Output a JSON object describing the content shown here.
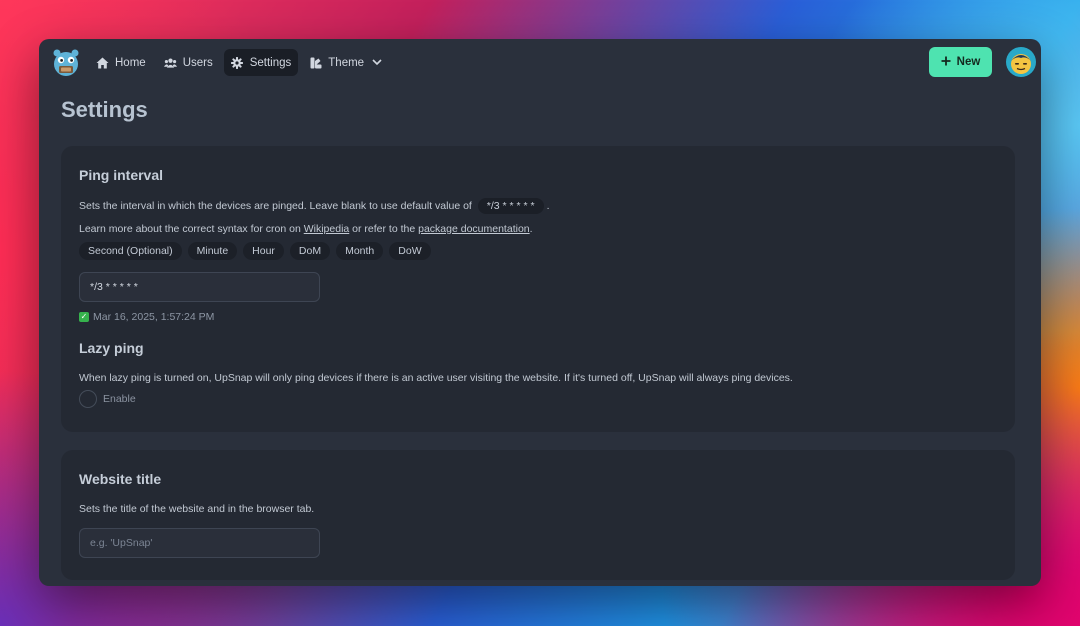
{
  "nav": {
    "home": "Home",
    "users": "Users",
    "settings": "Settings",
    "theme": "Theme",
    "new_button": "New"
  },
  "page": {
    "title": "Settings"
  },
  "ping_interval": {
    "title": "Ping interval",
    "desc_prefix": "Sets the interval in which the devices are pinged. Leave blank to use default value of",
    "default_value": "*/3 * * * * *",
    "desc_suffix": ".",
    "learn_prefix": "Learn more about the correct syntax for cron on",
    "wikipedia": "Wikipedia",
    "learn_middle": "or refer to the",
    "package_docs": "package documentation",
    "learn_suffix": ".",
    "fields": [
      "Second (Optional)",
      "Minute",
      "Hour",
      "DoM",
      "Month",
      "DoW"
    ],
    "input_value": "*/3 * * * * *",
    "status_text": "Mar 16, 2025, 1:57:24 PM"
  },
  "lazy_ping": {
    "title": "Lazy ping",
    "desc": "When lazy ping is turned on, UpSnap will only ping devices if there is an active user visiting the website. If it's turned off, UpSnap will always ping devices.",
    "toggle_label": "Enable"
  },
  "website_title": {
    "title": "Website title",
    "desc": "Sets the title of the website and in the browser tab.",
    "placeholder": "e.g. 'UpSnap'"
  },
  "colors": {
    "accent": "#4ee3b0",
    "window_bg": "#2a303c",
    "card_bg": "#242933"
  }
}
